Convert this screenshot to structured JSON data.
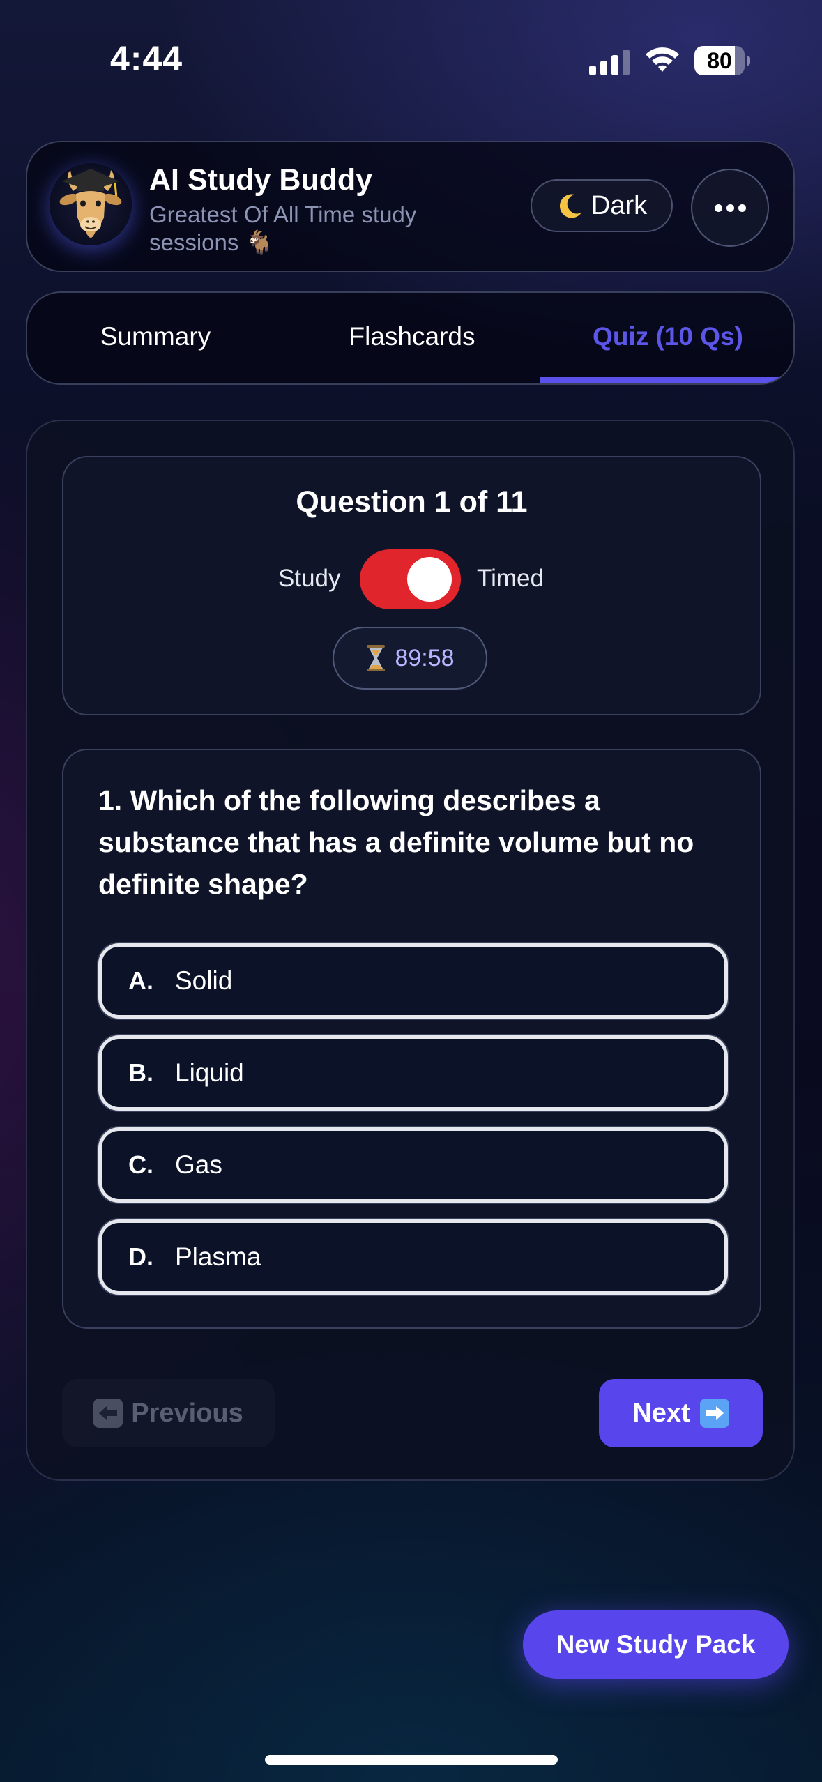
{
  "status_bar": {
    "time": "4:44",
    "battery": "80",
    "signal_icon": "cellular-signal-icon",
    "wifi_icon": "wifi-icon",
    "battery_icon": "battery-icon"
  },
  "header": {
    "avatar_icon": "goat-graduate-avatar",
    "title": "AI Study Buddy",
    "subtitle": "Greatest Of All Time study sessions 🐐",
    "theme_icon": "moon-icon",
    "theme_label": "Dark",
    "more_icon": "more-dots-icon"
  },
  "tabs": [
    {
      "label": "Summary",
      "active": false
    },
    {
      "label": "Flashcards",
      "active": false
    },
    {
      "label": "Quiz (10 Qs)",
      "active": true
    }
  ],
  "quiz": {
    "counter": "Question 1 of 11",
    "mode": {
      "left_label": "Study",
      "right_label": "Timed",
      "timed_on": true
    },
    "timer": "89:58",
    "timer_icon": "hourglass-icon",
    "question": "1. Which of the following describes a substance that has a definite volume but no definite shape?",
    "options": [
      {
        "letter": "A.",
        "text": "Solid"
      },
      {
        "letter": "B.",
        "text": "Liquid"
      },
      {
        "letter": "C.",
        "text": "Gas"
      },
      {
        "letter": "D.",
        "text": "Plasma"
      }
    ],
    "previous_label": "Previous",
    "previous_icon": "left-arrow-icon",
    "next_label": "Next",
    "next_icon": "right-arrow-icon"
  },
  "new_pack_label": "New Study Pack",
  "colors": {
    "accent": "#5846ec",
    "tab_active": "#5b56e8",
    "toggle_on": "#e0252c",
    "timer_text": "#b8b4ff"
  }
}
